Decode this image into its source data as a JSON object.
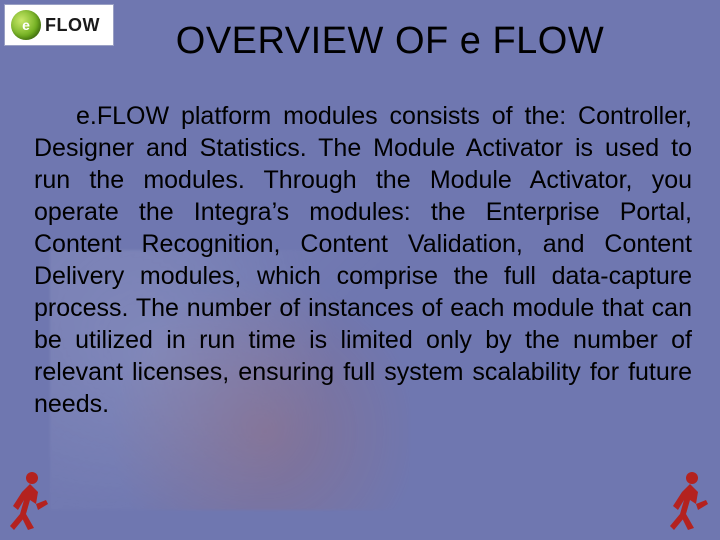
{
  "logo": {
    "badge_letter": "e",
    "word": "FLOW",
    "name": "eflow-logo"
  },
  "title": "OVERVIEW OF e FLOW",
  "body_text": "e.FLOW platform modules consists of the: Controller, Designer and Statistics. The Module Activator is used to run the modules. Through the Module Activator, you operate the Integra’s modules: the Enterprise Portal, Content Recognition, Content Validation, and Content Delivery modules, which comprise the full data-capture process. The number of instances of each module that can be utilized in run time is limited only by the number of relevant licenses, ensuring full system scalability for future needs.",
  "icons": {
    "walker_left": "walking-person-icon",
    "walker_right": "walking-person-icon"
  },
  "colors": {
    "slide_bg": "#6f77b0",
    "walker_fill": "#b4221f"
  }
}
